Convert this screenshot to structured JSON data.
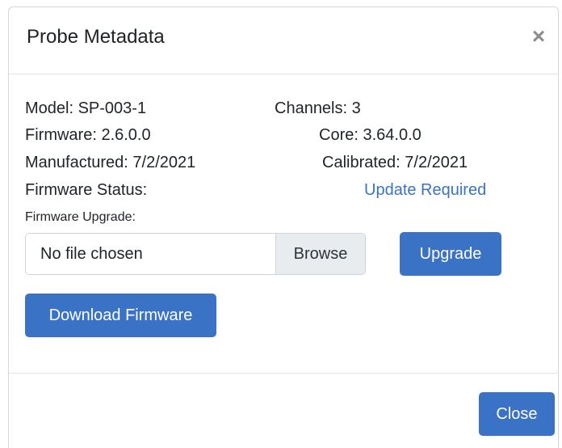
{
  "modal": {
    "title": "Probe Metadata",
    "close_glyph": "×"
  },
  "details": {
    "model": "Model: SP-003-1",
    "channels": "Channels: 3",
    "firmware": "Firmware: 2.6.0.0",
    "core": "Core: 3.64.0.0",
    "manufactured": "Manufactured: 7/2/2021",
    "calibrated": "Calibrated: 7/2/2021",
    "firmware_status_label": "Firmware Status:",
    "firmware_status_value": "Update Required"
  },
  "upgrade": {
    "label": "Firmware Upgrade:",
    "file_text": "No file chosen",
    "browse_label": "Browse",
    "upgrade_label": "Upgrade"
  },
  "download_label": "Download Firmware",
  "footer": {
    "close_label": "Close"
  },
  "colors": {
    "primary": "#3a72c6",
    "link": "#3a72c6"
  }
}
